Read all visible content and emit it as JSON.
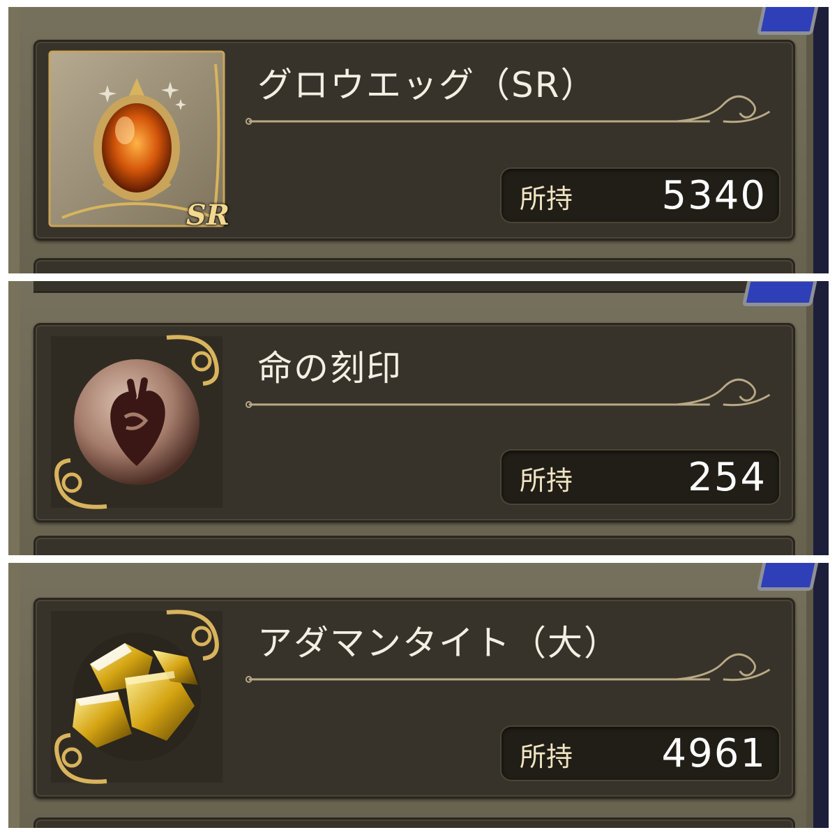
{
  "items": [
    {
      "name": "グロウエッグ（SR）",
      "owned_label": "所持",
      "owned_value": "5340",
      "rarity_badge": "SR",
      "icon": "growth-egg-icon"
    },
    {
      "name": "命の刻印",
      "owned_label": "所持",
      "owned_value": "254",
      "icon": "life-seal-icon"
    },
    {
      "name": "アダマンタイト（大）",
      "owned_label": "所持",
      "owned_value": "4961",
      "icon": "adamantite-icon"
    }
  ],
  "colors": {
    "card_bg": "#37332a",
    "frame_bg": "#6f6a55",
    "accent_gold": "#c9a45a",
    "text": "#f3efe4"
  }
}
